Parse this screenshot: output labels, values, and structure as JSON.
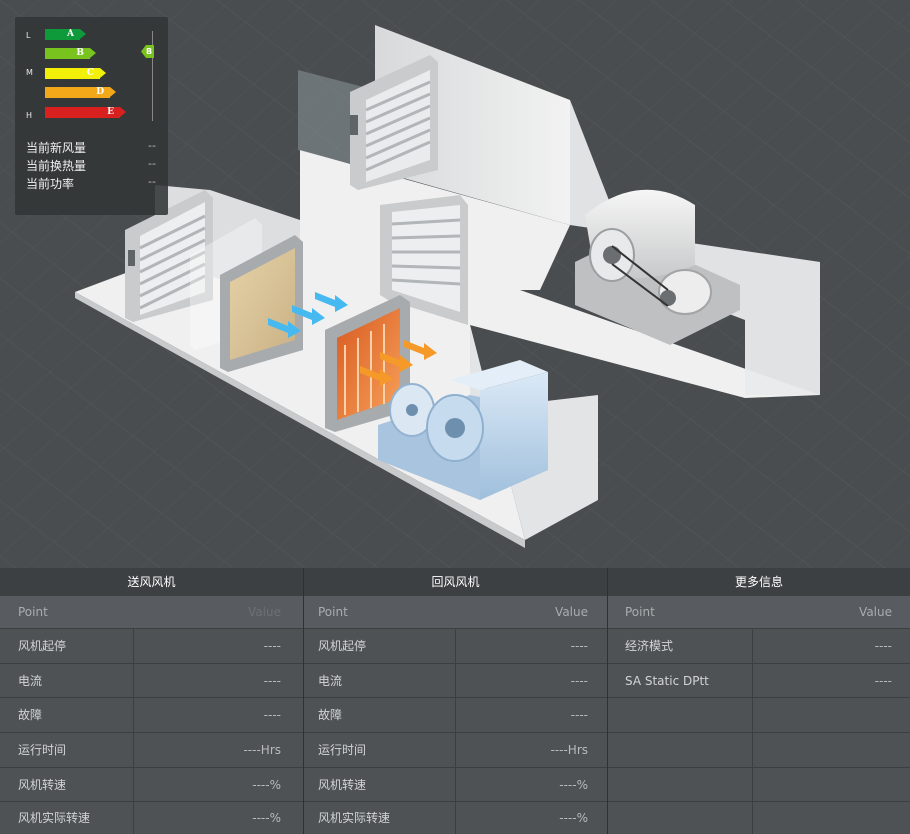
{
  "energy": {
    "levels": [
      "L",
      "M",
      "H"
    ],
    "grades": [
      "A",
      "B",
      "C",
      "D",
      "E"
    ],
    "current_grade": "B",
    "stats": [
      {
        "label": "当前新风量",
        "value": "--"
      },
      {
        "label": "当前换热量",
        "value": "--"
      },
      {
        "label": "当前功率",
        "value": "--"
      }
    ]
  },
  "supply_fan": {
    "title": "送风风机",
    "point_header": "Point",
    "value_header": "Value",
    "rows": [
      {
        "label": "风机起停",
        "value": "----"
      },
      {
        "label": "电流",
        "value": "----"
      },
      {
        "label": "故障",
        "value": "----"
      },
      {
        "label": "运行时间",
        "value": "----Hrs"
      },
      {
        "label": "风机转速",
        "value": "----%"
      },
      {
        "label": "风机实际转速",
        "value": "----%"
      }
    ]
  },
  "return_fan": {
    "title": "回风风机",
    "point_header": "Point",
    "value_header": "Value",
    "rows": [
      {
        "label": "风机起停",
        "value": "----"
      },
      {
        "label": "电流",
        "value": "----"
      },
      {
        "label": "故障",
        "value": "----"
      },
      {
        "label": "运行时间",
        "value": "----Hrs"
      },
      {
        "label": "风机转速",
        "value": "----%"
      },
      {
        "label": "风机实际转速",
        "value": "----%"
      }
    ]
  },
  "more_info": {
    "title": "更多信息",
    "point_header": "Point",
    "value_header": "Value",
    "rows": [
      {
        "label": "经济模式",
        "value": "----"
      },
      {
        "label": "SA Static DPtt",
        "value": "----"
      },
      {
        "label": "",
        "value": ""
      },
      {
        "label": "",
        "value": ""
      },
      {
        "label": "",
        "value": ""
      },
      {
        "label": "",
        "value": ""
      }
    ]
  },
  "colors": {
    "grade_a": "#0e9a3a",
    "grade_b": "#78c31e",
    "grade_c": "#f2ef08",
    "grade_d": "#f3a81a",
    "grade_e": "#d8201f"
  }
}
